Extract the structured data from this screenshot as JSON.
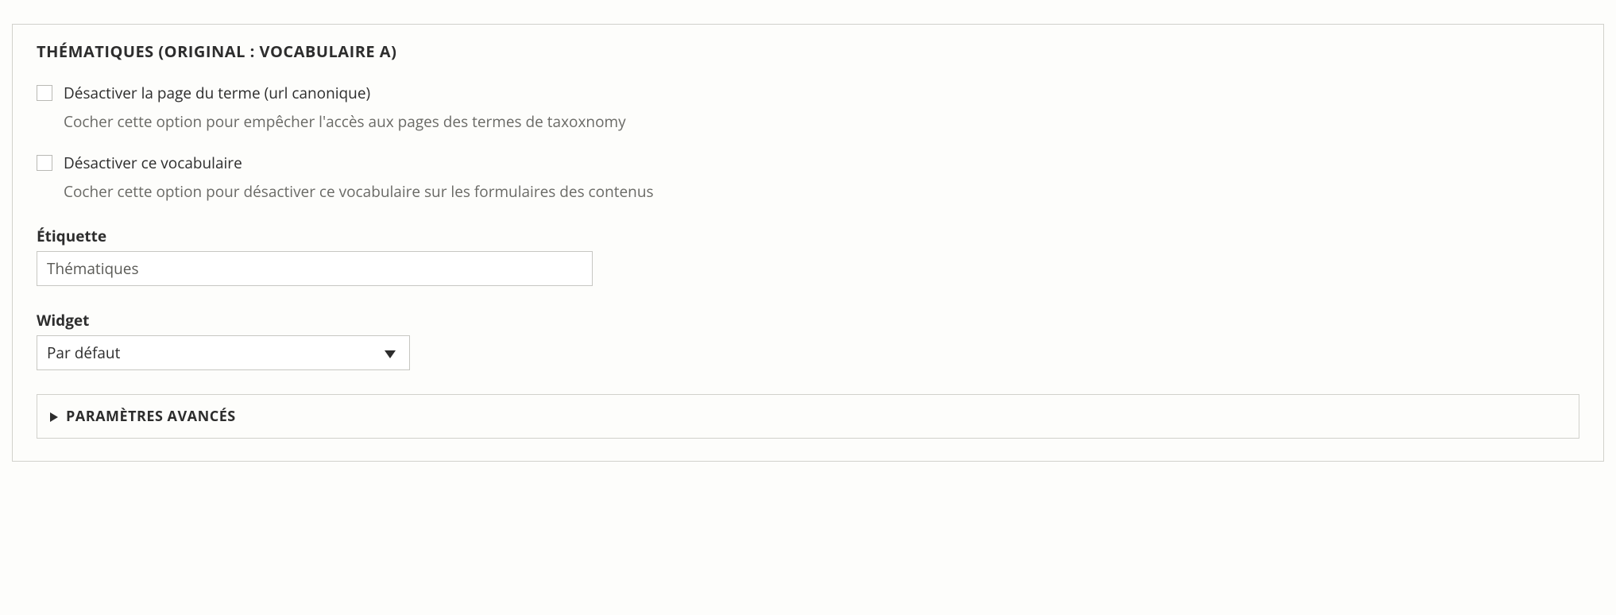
{
  "panel": {
    "title": "THÉMATIQUES (ORIGINAL : VOCABULAIRE A)"
  },
  "options": {
    "disable_term_page": {
      "label": "Désactiver la page du terme (url canonique)",
      "help": "Cocher cette option pour empêcher l'accès aux pages des termes de taxoxnomy",
      "checked": false
    },
    "disable_vocabulary": {
      "label": "Désactiver ce vocabulaire",
      "help": "Cocher cette option pour désactiver ce vocabulaire sur les formulaires des contenus",
      "checked": false
    }
  },
  "etiquette": {
    "label": "Étiquette",
    "value": "Thématiques"
  },
  "widget": {
    "label": "Widget",
    "selected": "Par défaut"
  },
  "advanced": {
    "title": "PARAMÈTRES AVANCÉS"
  }
}
